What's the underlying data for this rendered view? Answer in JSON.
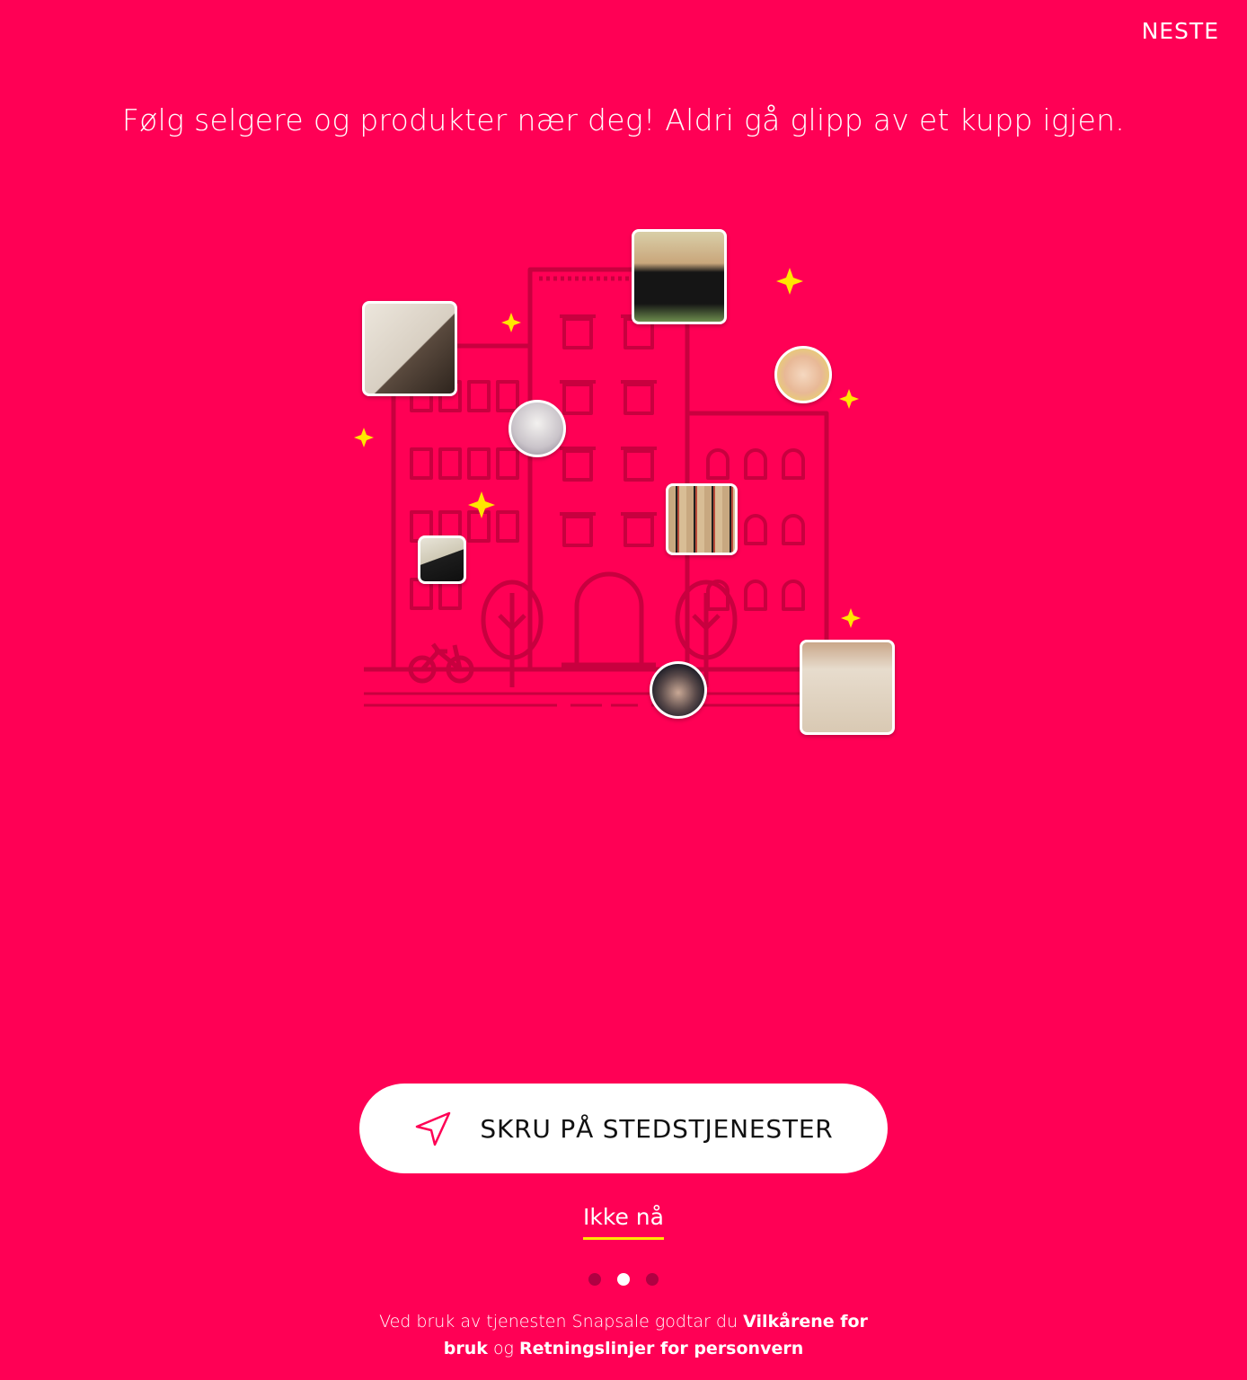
{
  "header": {
    "next_label": "NESTE"
  },
  "main": {
    "headline": "Følg selgere og produkter nær deg! Aldri gå glipp av et kupp igjen."
  },
  "cta": {
    "label": "SKRU PÅ STEDSTJENESTER",
    "icon": "location-arrow-icon"
  },
  "skip": {
    "label": "Ikke nå"
  },
  "pager": {
    "total": 3,
    "active_index": 1
  },
  "legal": {
    "prefix": "Ved bruk av tjenesten Snapsale godtar du",
    "terms_link": "Vilkårene for bruk",
    "conjunction": "og",
    "privacy_link": "Retningslinjer for personvern"
  },
  "colors": {
    "background": "#ff0055",
    "illustration_line": "#c8003f",
    "sparkle": "#ffe600",
    "button_bg": "#ffffff",
    "underline": "#ffe600"
  }
}
